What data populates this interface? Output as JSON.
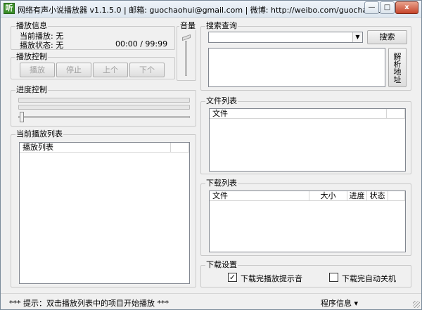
{
  "window": {
    "title": "网络有声小说播放器 v1.1.5.0 | 邮箱: guochaohui@gmail.com | 微博: http://weibo.com/guochaohui",
    "app_icon_glyph": "听",
    "controls": {
      "minimize": "—",
      "maximize": "□",
      "close": "x"
    }
  },
  "play_info": {
    "legend": "播放信息",
    "current_label": "当前播放: 无",
    "status_label": "播放状态: 无",
    "time": "00:00  /  99:99"
  },
  "volume": {
    "legend": "音量"
  },
  "play_control": {
    "legend": "播放控制",
    "buttons": [
      "播放",
      "停止",
      "上个",
      "下个"
    ]
  },
  "progress": {
    "legend": "进度控制"
  },
  "current_playlist": {
    "legend": "当前播放列表",
    "columns": [
      "播放列表"
    ]
  },
  "search": {
    "legend": "搜索查询",
    "input_value": "",
    "search_button": "搜索",
    "parse_button_chars": [
      "解",
      "析",
      "地",
      "址"
    ]
  },
  "file_list": {
    "legend": "文件列表",
    "columns": [
      "文件"
    ]
  },
  "download_list": {
    "legend": "下载列表",
    "columns": [
      "文件",
      "大小",
      "进度",
      "状态"
    ]
  },
  "download_settings": {
    "legend": "下载设置",
    "option1": {
      "label": "下载完播放提示音",
      "checked": true
    },
    "option2": {
      "label": "下载完自动关机",
      "checked": false
    }
  },
  "statusbar": {
    "hint": "*** 提示：双击播放列表中的项目开始播放 ***",
    "program_info": "程序信息 ▾"
  }
}
